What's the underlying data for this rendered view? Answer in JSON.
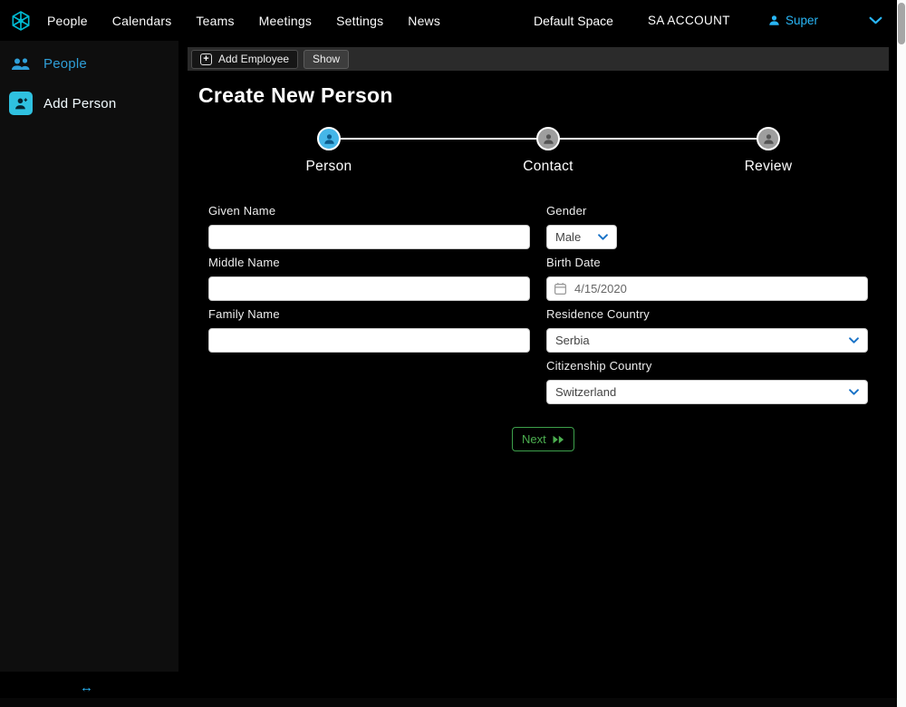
{
  "navbar": {
    "items": [
      {
        "label": "People"
      },
      {
        "label": "Calendars"
      },
      {
        "label": "Teams"
      },
      {
        "label": "Meetings"
      },
      {
        "label": "Settings"
      },
      {
        "label": "News"
      }
    ],
    "space_label": "Default Space",
    "account_label": "SA ACCOUNT",
    "user_label": "Super"
  },
  "sidebar": {
    "items": [
      {
        "label": "People",
        "icon": "people-icon"
      },
      {
        "label": "Add Person",
        "icon": "person-add-icon"
      }
    ],
    "collapse_icon": "↔"
  },
  "toolbar": {
    "add_employee_label": "Add Employee",
    "show_label": "Show"
  },
  "page": {
    "title": "Create New Person"
  },
  "stepper": {
    "steps": [
      {
        "label": "Person",
        "state": "active"
      },
      {
        "label": "Contact",
        "state": "inactive"
      },
      {
        "label": "Review",
        "state": "inactive"
      }
    ]
  },
  "form": {
    "given_name": {
      "label": "Given Name",
      "value": ""
    },
    "middle_name": {
      "label": "Middle Name",
      "value": ""
    },
    "family_name": {
      "label": "Family Name",
      "value": ""
    },
    "gender": {
      "label": "Gender",
      "value": "Male"
    },
    "birth_date": {
      "label": "Birth Date",
      "value": "4/15/2020"
    },
    "residence_country": {
      "label": "Residence Country",
      "value": "Serbia"
    },
    "citizenship_country": {
      "label": "Citizenship Country",
      "value": "Switzerland"
    },
    "next_label": "Next"
  },
  "icons": {
    "plus": "+",
    "brand": "snowflake-logo-icon",
    "user": "person-icon",
    "dropdown": "chevron-down-icon",
    "calendar": "calendar-icon",
    "next": "fast-forward-icon"
  },
  "colors": {
    "accent_cyan": "#29b6f6",
    "logo_teal": "#00bcd4",
    "step_active_blue": "#45b6e8",
    "button_green": "#4caf50"
  }
}
